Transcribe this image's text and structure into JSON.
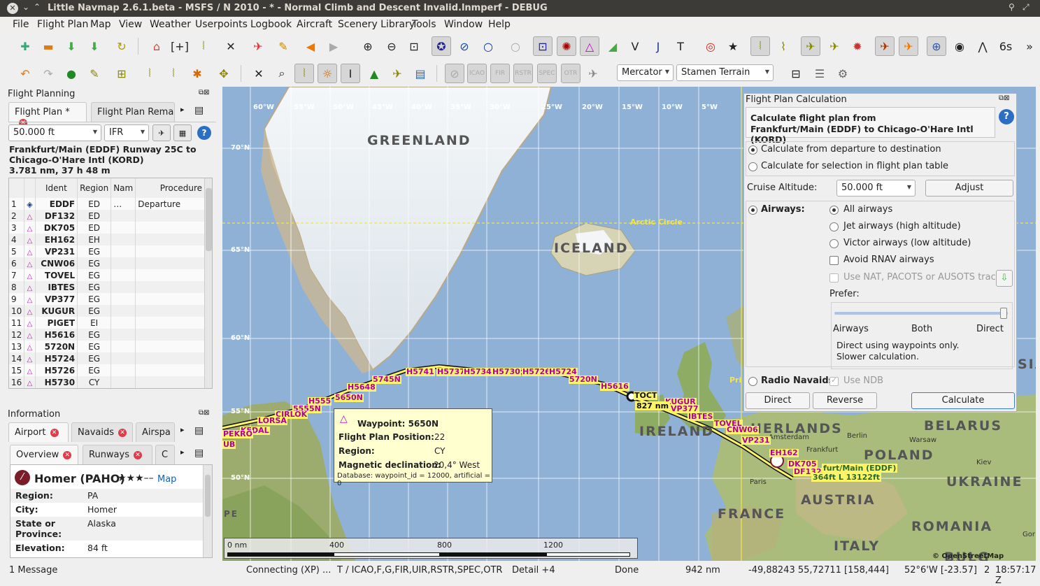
{
  "window": {
    "title": "Little Navmap 2.6.1.beta - MSFS / N 2010 - * - Normal Climb and Descent Invalid.lnmperf - DEBUG"
  },
  "menu": {
    "file": "File",
    "flight_plan": "Flight Plan",
    "map": "Map",
    "view": "View",
    "weather": "Weather",
    "userpoints": "Userpoints",
    "logbook": "Logbook",
    "aircraft": "Aircraft",
    "scenery_library": "Scenery Library",
    "tools": "Tools",
    "window": "Window",
    "help": "Help"
  },
  "toolbar2": {
    "projection": "Mercator",
    "theme": "Stamen Terrain"
  },
  "flight_planning": {
    "title": "Flight Planning",
    "tab_active": "Flight Plan *",
    "tab_other": "Flight Plan Remar",
    "altitude": "50.000 ft",
    "rules": "IFR",
    "summary_line1": "Frankfurt/Main (EDDF) Runway 25C to",
    "summary_line2": "Chicago-O'Hare Intl (KORD)",
    "summary_line3": "3.781 nm, 37 h 48 m",
    "columns": [
      "Ident",
      "Region",
      "Nam",
      "Procedure"
    ],
    "rows": [
      {
        "n": "1",
        "ident": "EDDF",
        "region": "ED",
        "name": "…",
        "proc": "Departure"
      },
      {
        "n": "2",
        "ident": "DF132",
        "region": "ED",
        "name": "",
        "proc": ""
      },
      {
        "n": "3",
        "ident": "DK705",
        "region": "ED",
        "name": "",
        "proc": ""
      },
      {
        "n": "4",
        "ident": "EH162",
        "region": "EH",
        "name": "",
        "proc": ""
      },
      {
        "n": "5",
        "ident": "VP231",
        "region": "EG",
        "name": "",
        "proc": ""
      },
      {
        "n": "6",
        "ident": "CNW06",
        "region": "EG",
        "name": "",
        "proc": ""
      },
      {
        "n": "7",
        "ident": "TOVEL",
        "region": "EG",
        "name": "",
        "proc": ""
      },
      {
        "n": "8",
        "ident": "IBTES",
        "region": "EG",
        "name": "",
        "proc": ""
      },
      {
        "n": "9",
        "ident": "VP377",
        "region": "EG",
        "name": "",
        "proc": ""
      },
      {
        "n": "10",
        "ident": "KUGUR",
        "region": "EG",
        "name": "",
        "proc": ""
      },
      {
        "n": "11",
        "ident": "PIGET",
        "region": "EI",
        "name": "",
        "proc": ""
      },
      {
        "n": "12",
        "ident": "H5616",
        "region": "EG",
        "name": "",
        "proc": ""
      },
      {
        "n": "13",
        "ident": "5720N",
        "region": "EG",
        "name": "",
        "proc": ""
      },
      {
        "n": "14",
        "ident": "H5724",
        "region": "EG",
        "name": "",
        "proc": ""
      },
      {
        "n": "15",
        "ident": "H5726",
        "region": "EG",
        "name": "",
        "proc": ""
      },
      {
        "n": "16",
        "ident": "H5730",
        "region": "CY",
        "name": "",
        "proc": ""
      }
    ]
  },
  "information": {
    "title": "Information",
    "tabs": [
      "Airport",
      "Navaids",
      "Airspa"
    ],
    "subtabs": [
      "Overview",
      "Runways",
      "C"
    ],
    "airport_name": "Homer (PAHO)",
    "stars": "★★★––",
    "map_link": "Map",
    "fields": [
      {
        "label": "Region:",
        "value": "PA"
      },
      {
        "label": "City:",
        "value": "Homer"
      },
      {
        "label": "State or\nProvince:",
        "value": "Alaska"
      },
      {
        "label": "Elevation:",
        "value": "84 ft"
      }
    ]
  },
  "map": {
    "lon_labels": [
      "60°W",
      "55°W",
      "50°W",
      "45°W",
      "40°W",
      "35°W",
      "30°W",
      "25°W",
      "20°W",
      "15°W",
      "10°W",
      "5°W"
    ],
    "lat_labels": [
      "70°N",
      "65°N",
      "60°N",
      "55°N",
      "50°N"
    ],
    "greenland": "GREENLAND",
    "iceland": "ICELAND",
    "ireland": "IRELAND",
    "nederlands": "HERLANDS",
    "belarus": "BELARUS",
    "poland": "POLAND",
    "ukraine": "UKRAINE",
    "france": "FRANCE",
    "austria": "AUSTRIA",
    "romania": "ROMANIA",
    "italy": "ITALY",
    "bulg": "BULG",
    "arctic_circle": "Arctic Circle",
    "cities": {
      "amsterdam": "Amsterdam",
      "berlin": "Berlin",
      "warsaw": "Warsaw",
      "kiev": "Kiev",
      "paris": "Paris",
      "frankfurt": "Frankfurt"
    },
    "pri": "Pri",
    "sia": "SIA",
    "pe": "PE",
    "gor": "Gor",
    "waypoints": [
      "H5741",
      "H5737",
      "H5734",
      "H5730",
      "H5726",
      "H5724",
      "5745N",
      "H5648",
      "5650N",
      "H555",
      "5555N",
      "CIRLOK",
      "LORSA",
      "KEDAL",
      "PEKRO",
      "UB",
      "5720N",
      "H5616",
      "TOCT",
      "KUGUR",
      "VP377",
      "IBTES",
      "TOVEL",
      "CNW06",
      "VP231",
      "EH162",
      "DK705",
      "DF132"
    ],
    "toc_dist": "827 nm",
    "dest_label": "furt/Main (EDDF)",
    "dest_sub": "364ft L 13122ft",
    "scale": [
      "0 nm",
      "400",
      "800",
      "1200"
    ],
    "copyright": "© OpenStreetMap contributors"
  },
  "tooltip": {
    "title": "Waypoint: 5650N",
    "rows": [
      {
        "k": "Flight Plan Position:",
        "v": "22"
      },
      {
        "k": "Region:",
        "v": "CY"
      },
      {
        "k": "Magnetic declination:",
        "v": "20,4° West"
      }
    ],
    "footer": "Database: waypoint_id = 12000, artificial = 0"
  },
  "calc": {
    "title": "Flight Plan Calculation",
    "heading1": "Calculate flight plan from",
    "heading2": "Frankfurt/Main (EDDF) to Chicago-O'Hare Intl (KORD)",
    "opt_dep_dest": "Calculate from departure to destination",
    "opt_selection": "Calculate for selection in flight plan table",
    "cruise_label": "Cruise Altitude:",
    "cruise_value": "50.000 ft",
    "adjust": "Adjust",
    "airways_label": "Airways:",
    "all_airways": "All airways",
    "jet_airways": "Jet airways (high altitude)",
    "victor_airways": "Victor airways (low altitude)",
    "avoid_rnav": "Avoid RNAV airways",
    "use_tracks": "Use NAT, PACOTS or AUSOTS tracks",
    "prefer": "Prefer:",
    "pref_airways": "Airways",
    "pref_both": "Both",
    "pref_direct": "Direct",
    "pref_desc1": "Direct using waypoints only.",
    "pref_desc2": "Slower calculation.",
    "radio_navaids": "Radio Navaids:",
    "use_ndb": "Use NDB",
    "btn_direct": "Direct",
    "btn_reverse": "Reverse",
    "btn_calculate": "Calculate"
  },
  "status": {
    "messages": "1 Message",
    "connecting": "Connecting (XP) ...",
    "layers": "T / ICAO,F,G,FIR,UIR,RSTR,SPEC,OTR",
    "detail": "Detail +4",
    "done": "Done",
    "dist": "942 nm",
    "coords": "-49,88243 55,72711 [158,444]",
    "pos": "52°6'W [-23.57]",
    "zoom": "2",
    "time": "18:57:17 Z"
  }
}
